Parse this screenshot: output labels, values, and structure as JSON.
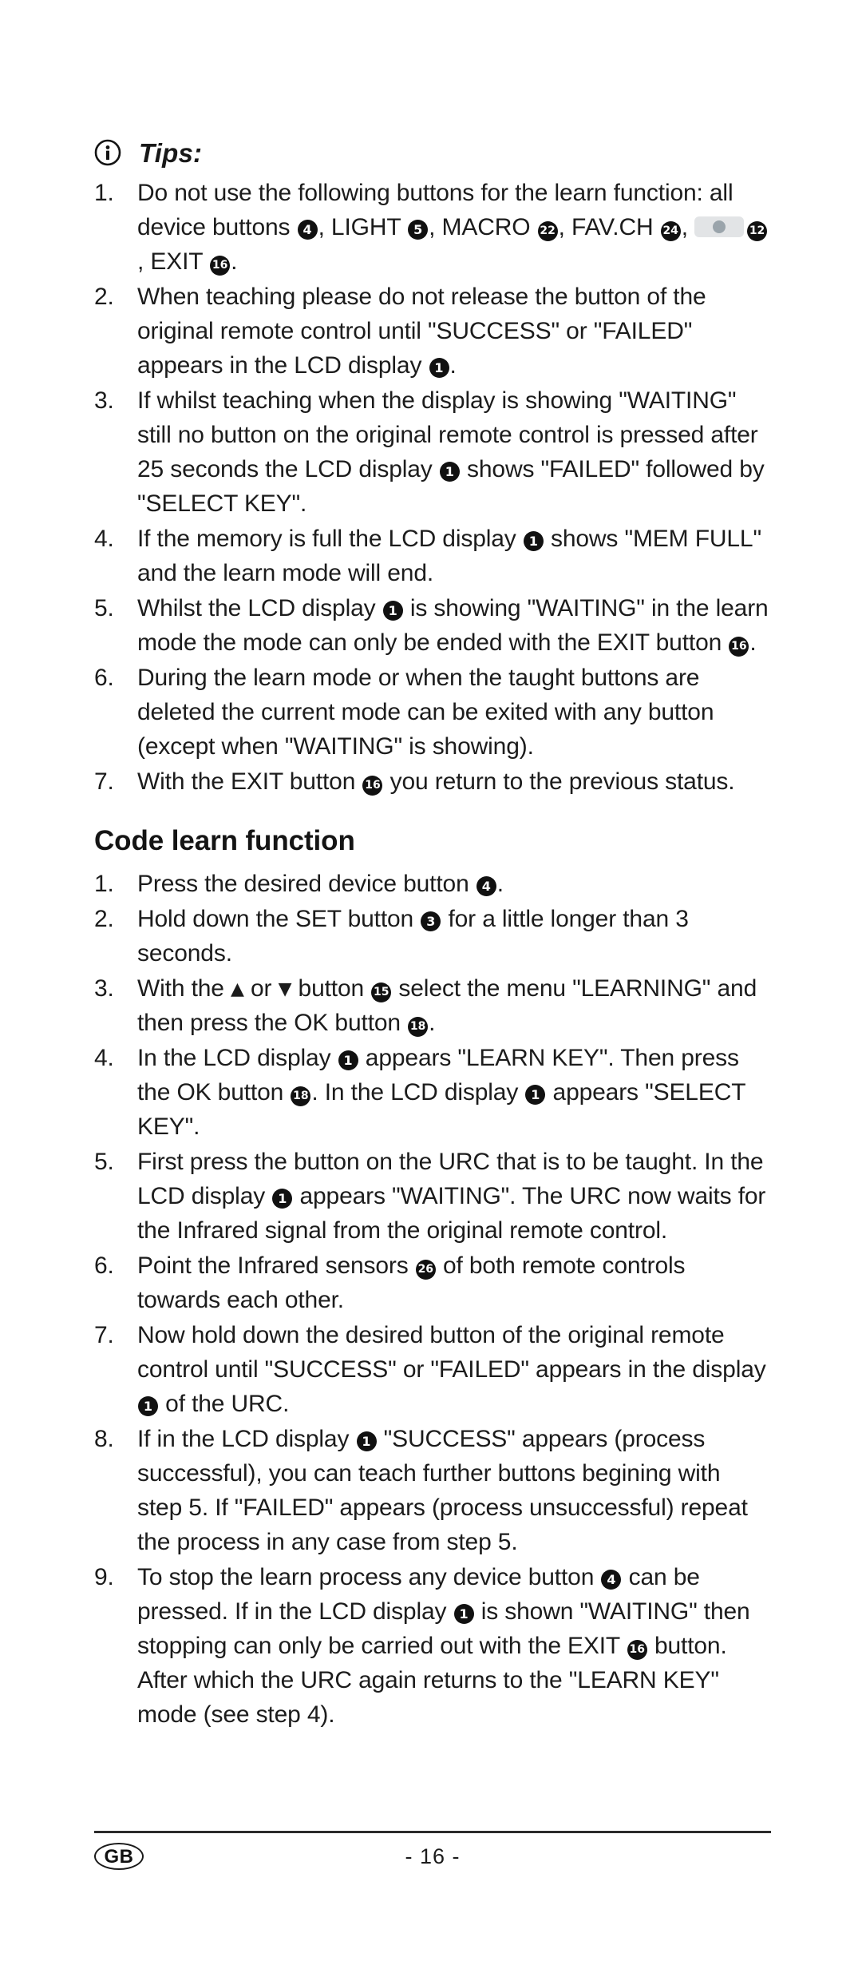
{
  "tips": {
    "icon": "info-circle-icon",
    "title": "Tips:",
    "items": [
      {
        "num": "1.",
        "segments": [
          {
            "t": "text",
            "v": "Do not use the following buttons for the learn function: all device buttons "
          },
          {
            "t": "ref",
            "v": "4"
          },
          {
            "t": "text",
            "v": ", LIGHT "
          },
          {
            "t": "ref",
            "v": "5"
          },
          {
            "t": "text",
            "v": ", MACRO "
          },
          {
            "t": "ref",
            "v": "22"
          },
          {
            "t": "text",
            "v": ", FAV.CH "
          },
          {
            "t": "ref",
            "v": "24"
          },
          {
            "t": "text",
            "v": ", "
          },
          {
            "t": "button-graphic",
            "v": "round-button-graphic"
          },
          {
            "t": "ref",
            "v": "12"
          },
          {
            "t": "text",
            "v": ", EXIT "
          },
          {
            "t": "ref",
            "v": "16"
          },
          {
            "t": "text",
            "v": "."
          }
        ]
      },
      {
        "num": "2.",
        "segments": [
          {
            "t": "text",
            "v": "When teaching please do not release the button of the original remote control until \"SUCCESS\" or \"FAILED\" appears in the LCD display "
          },
          {
            "t": "ref",
            "v": "1"
          },
          {
            "t": "text",
            "v": "."
          }
        ]
      },
      {
        "num": "3.",
        "segments": [
          {
            "t": "text",
            "v": "If whilst teaching when the display is showing \"WAITING\" still no button on the original remote control is pressed after 25 seconds the LCD display "
          },
          {
            "t": "ref",
            "v": "1"
          },
          {
            "t": "text",
            "v": " shows \"FAILED\" followed by \"SELECT KEY\"."
          }
        ]
      },
      {
        "num": "4.",
        "segments": [
          {
            "t": "text",
            "v": "If the memory is full the LCD display "
          },
          {
            "t": "ref",
            "v": "1"
          },
          {
            "t": "text",
            "v": " shows \"MEM FULL\" and the learn mode will end."
          }
        ]
      },
      {
        "num": "5.",
        "segments": [
          {
            "t": "text",
            "v": "Whilst the LCD display "
          },
          {
            "t": "ref",
            "v": "1"
          },
          {
            "t": "text",
            "v": " is showing \"WAITING\" in the learn mode the mode can only be ended with the EXIT button "
          },
          {
            "t": "ref",
            "v": "16"
          },
          {
            "t": "text",
            "v": "."
          }
        ]
      },
      {
        "num": "6.",
        "segments": [
          {
            "t": "text",
            "v": "During the learn mode or when the taught buttons are deleted the current mode can be exited with any button (except when \"WAITING\" is showing)."
          }
        ]
      },
      {
        "num": "7.",
        "segments": [
          {
            "t": "text",
            "v": "With the EXIT button "
          },
          {
            "t": "ref",
            "v": "16"
          },
          {
            "t": "text",
            "v": " you return to the previous status."
          }
        ]
      }
    ]
  },
  "code_learn": {
    "heading": "Code learn function",
    "items": [
      {
        "num": "1.",
        "segments": [
          {
            "t": "text",
            "v": "Press the desired device button "
          },
          {
            "t": "ref",
            "v": "4"
          },
          {
            "t": "text",
            "v": "."
          }
        ]
      },
      {
        "num": "2.",
        "segments": [
          {
            "t": "text",
            "v": "Hold down the SET button "
          },
          {
            "t": "ref",
            "v": "3"
          },
          {
            "t": "text",
            "v": " for a little longer than 3 seconds."
          }
        ]
      },
      {
        "num": "3.",
        "segments": [
          {
            "t": "text",
            "v": "With the "
          },
          {
            "t": "glyph",
            "v": "▲",
            "name": "up-triangle-icon"
          },
          {
            "t": "text",
            "v": " or "
          },
          {
            "t": "glyph",
            "v": "▼",
            "name": "down-triangle-icon"
          },
          {
            "t": "text",
            "v": " button "
          },
          {
            "t": "ref",
            "v": "15"
          },
          {
            "t": "text",
            "v": " select the menu \"LEARNING\" and then press the OK button "
          },
          {
            "t": "ref",
            "v": "18"
          },
          {
            "t": "text",
            "v": "."
          }
        ]
      },
      {
        "num": "4.",
        "segments": [
          {
            "t": "text",
            "v": "In the LCD display "
          },
          {
            "t": "ref",
            "v": "1"
          },
          {
            "t": "text",
            "v": " appears \"LEARN KEY\". Then press the OK button "
          },
          {
            "t": "ref",
            "v": "18"
          },
          {
            "t": "text",
            "v": ". In the LCD display "
          },
          {
            "t": "ref",
            "v": "1"
          },
          {
            "t": "text",
            "v": " appears \"SELECT KEY\"."
          }
        ]
      },
      {
        "num": "5.",
        "segments": [
          {
            "t": "text",
            "v": "First press the button on the URC that is to be taught. In the LCD display "
          },
          {
            "t": "ref",
            "v": "1"
          },
          {
            "t": "text",
            "v": " appears \"WAITING\". The URC now waits for the Infrared signal from the original remote control."
          }
        ]
      },
      {
        "num": "6.",
        "segments": [
          {
            "t": "text",
            "v": "Point the Infrared sensors "
          },
          {
            "t": "ref",
            "v": "26"
          },
          {
            "t": "text",
            "v": " of both remote controls towards each other."
          }
        ]
      },
      {
        "num": "7.",
        "segments": [
          {
            "t": "text",
            "v": "Now hold down the desired button of the original remote control until \"SUCCESS\" or \"FAILED\" appears in the display "
          },
          {
            "t": "ref",
            "v": "1"
          },
          {
            "t": "text",
            "v": " of the URC."
          }
        ]
      },
      {
        "num": "8.",
        "segments": [
          {
            "t": "text",
            "v": "If in the LCD display "
          },
          {
            "t": "ref",
            "v": "1"
          },
          {
            "t": "text",
            "v": " \"SUCCESS\" appears (process successful), you can teach further buttons begining with step 5. If \"FAILED\" appears (process unsuccessful) repeat the process in any case from step 5."
          }
        ]
      },
      {
        "num": "9.",
        "segments": [
          {
            "t": "text",
            "v": "To stop the learn process any device button "
          },
          {
            "t": "ref",
            "v": "4"
          },
          {
            "t": "text",
            "v": " can be pressed. If in the LCD display "
          },
          {
            "t": "ref",
            "v": "1"
          },
          {
            "t": "text",
            "v": " is shown \"WAITING\" then stopping can only be carried out with the EXIT "
          },
          {
            "t": "ref",
            "v": "16"
          },
          {
            "t": "text",
            "v": " button. After which the URC again returns to the \"LEARN KEY\" mode (see step 4)."
          }
        ]
      }
    ]
  },
  "footer": {
    "language_badge": "GB",
    "page_number": "- 16 -"
  }
}
